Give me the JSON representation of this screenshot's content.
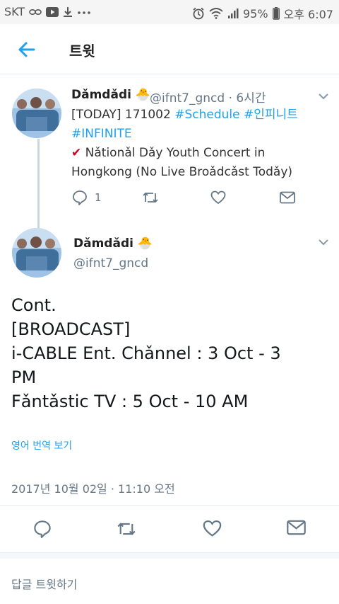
{
  "status_bar": {
    "carrier": "SKT",
    "battery": "95%",
    "time": "오후 6:07",
    "icons": [
      "link-icon",
      "youtube-icon",
      "download-icon",
      "more-dots-icon",
      "alarm-icon",
      "wifi-icon",
      "signal-icon",
      "battery-icon"
    ]
  },
  "header": {
    "title": "트윗",
    "back_icon": "back-arrow-icon"
  },
  "tweet1": {
    "name": "Dǎmdǎdi 🐣",
    "handle": "@ifnt7_gncd",
    "time": "· 6시간",
    "line1_prefix": "[TODAY] 171002 ",
    "hashtag1": "#Schedule",
    "hashtag2": " #인피니트",
    "hashtag3": "#INFINITE",
    "check": "✔",
    "line3": " Nǎtionǎl Dǎy Youth Concert in",
    "line4": "Hongkong (No Live Broǎdcǎst Todǎy)",
    "reply_count": "1"
  },
  "tweet2": {
    "name": "Dǎmdǎdi 🐣",
    "handle": "@ifnt7_gncd",
    "body_lines": [
      "Cont.",
      "[BROADCAST]",
      "i-CABLE Ent. Chǎnnel : 3 Oct - 3",
      "PM",
      "Fǎntǎstic TV : 5 Oct - 10 AM"
    ],
    "translate": "영어 번역 보기",
    "timestamp": "2017년 10월 02일 · 11:10 오전"
  },
  "reply_prompt": "답글 트윗하기",
  "colors": {
    "accent": "#1da1f2",
    "muted": "#657786",
    "check": "#d0021b"
  }
}
